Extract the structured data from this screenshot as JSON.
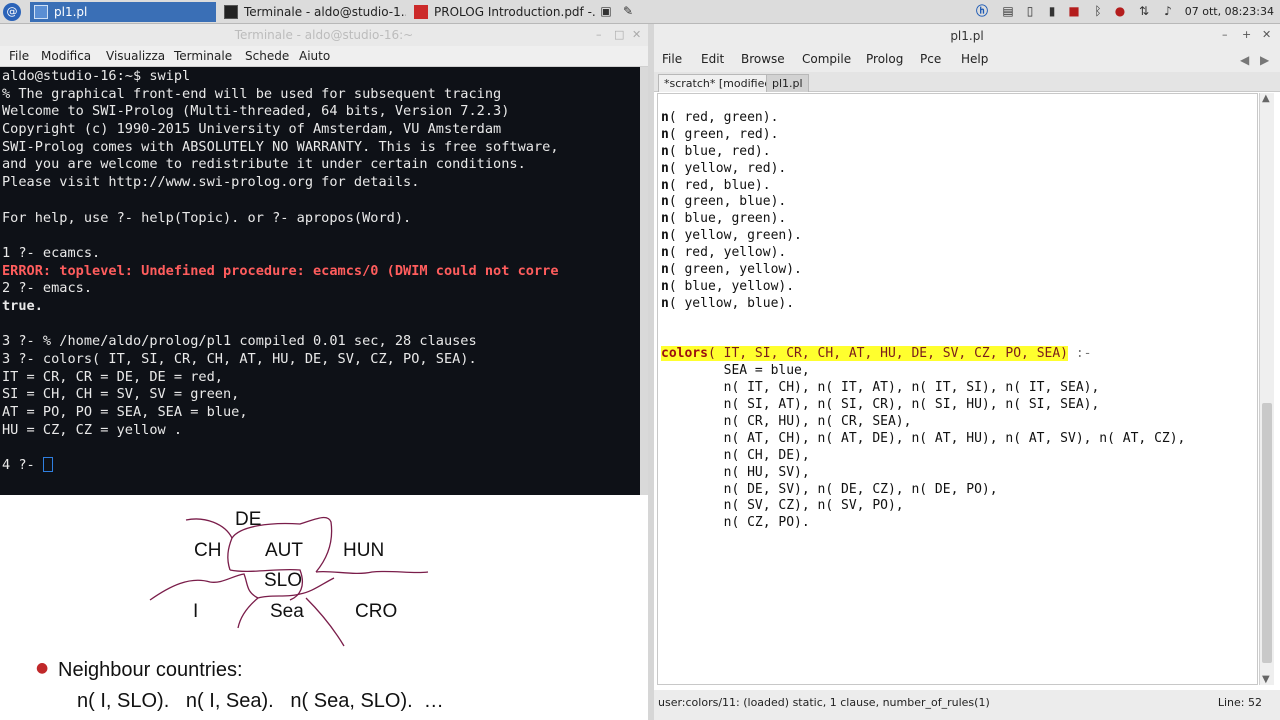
{
  "taskbar": {
    "start_icon": "debian-swirl-icon",
    "tasks": [
      {
        "label": "pl1.pl",
        "icon": "editor-icon"
      },
      {
        "label": "Terminale - aldo@studio-1...",
        "icon": "terminal-icon"
      },
      {
        "label": "PROLOG Introduction.pdf -...",
        "icon": "pdf-icon"
      }
    ],
    "clock": "07 ott, 08:23:34",
    "accent": "#3a6fb6"
  },
  "terminal": {
    "title": "Terminale - aldo@studio-16:~",
    "menu": [
      "File",
      "Modifica",
      "Visualizza",
      "Terminale",
      "Schede",
      "Aiuto"
    ],
    "lines": [
      "aldo@studio-16:~$ swipl",
      "% The graphical front-end will be used for subsequent tracing",
      "Welcome to SWI-Prolog (Multi-threaded, 64 bits, Version 7.2.3)",
      "Copyright (c) 1990-2015 University of Amsterdam, VU Amsterdam",
      "SWI-Prolog comes with ABSOLUTELY NO WARRANTY. This is free software,",
      "and you are welcome to redistribute it under certain conditions.",
      "Please visit http://www.swi-prolog.org for details.",
      "",
      "For help, use ?- help(Topic). or ?- apropos(Word).",
      "",
      "1 ?- ecamcs.",
      "ERROR: toplevel: Undefined procedure: ecamcs/0 (DWIM could not corre",
      "2 ?- emacs.",
      "true.",
      "",
      "3 ?- % /home/aldo/prolog/pl1 compiled 0.01 sec, 28 clauses",
      "3 ?- colors( IT, SI, CR, CH, AT, HU, DE, SV, CZ, PO, SEA).",
      "IT = CR, CR = DE, DE = red,",
      "SI = CH, CH = SV, SV = green,",
      "AT = PO, PO = SEA, SEA = blue,",
      "HU = CZ, CZ = yellow .",
      "",
      "4 ?- "
    ]
  },
  "slide": {
    "map_labels": [
      "DE",
      "CH",
      "AUT",
      "HUN",
      "SLO",
      "I",
      "Sea",
      "CRO"
    ],
    "bullet": "Neighbour countries:",
    "facts": "n( I, SLO).   n( I, Sea).   n( Sea, SLO).  …"
  },
  "editor": {
    "title": "pl1.pl",
    "menu": [
      "File",
      "Edit",
      "Browse",
      "Compile",
      "Prolog",
      "Pce",
      "Help"
    ],
    "tabs": [
      "*scratch* [modified]",
      "pl1.pl"
    ],
    "facts": [
      "( red, green).",
      "( green, red).",
      "( blue, red).",
      "( yellow, red).",
      "( red, blue).",
      "( green, blue).",
      "( blue, green).",
      "( yellow, green).",
      "( red, yellow).",
      "( green, yellow).",
      "( blue, yellow).",
      "( yellow, blue)."
    ],
    "head_name": "colors",
    "head_args": "( IT, SI, CR, CH, AT, HU, DE, SV, CZ, PO, SEA)",
    "neck": " :-",
    "body": [
      "        SEA = blue,",
      "        n( IT, CH), n( IT, AT), n( IT, SI), n( IT, SEA),",
      "        n( SI, AT), n( SI, CR), n( SI, HU), n( SI, SEA),",
      "        n( CR, HU), n( CR, SEA),",
      "        n( AT, CH), n( AT, DE), n( AT, HU), n( AT, SV), n( AT, CZ),",
      "        n( CH, DE),",
      "        n( HU, SV),",
      "        n( DE, SV), n( DE, CZ), n( DE, PO),",
      "        n( SV, CZ), n( SV, PO),",
      "        n( CZ, PO)."
    ],
    "status": "user:colors/11: (loaded) static, 1 clause, number_of_rules(1)",
    "line": "Line: 52",
    "highlight_color": "#ffff2e"
  }
}
